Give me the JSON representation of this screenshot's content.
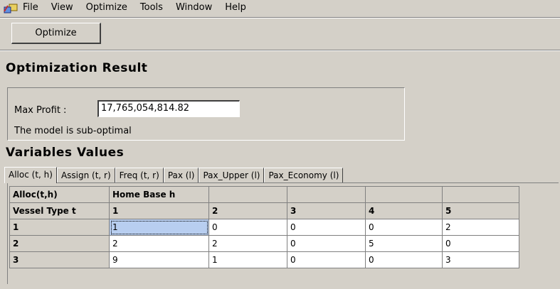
{
  "menu": {
    "app_icon": "app-window-icon",
    "items": [
      "File",
      "View",
      "Optimize",
      "Tools",
      "Window",
      "Help"
    ]
  },
  "toolbar": {
    "optimize_label": "Optimize"
  },
  "result": {
    "title": "Optimization Result",
    "max_profit_label": "Max Profit :",
    "max_profit_value": "17,765,054,814.82",
    "status_text": "The model is sub-optimal"
  },
  "variables": {
    "title": "Variables Values",
    "tabs": [
      "Alloc (t, h)",
      "Assign (t, r)",
      "Freq (t, r)",
      "Pax (l)",
      "Pax_Upper (l)",
      "Pax_Economy (l)"
    ],
    "active_tab": "Alloc (t, h)"
  },
  "grid": {
    "header_row1": [
      "Alloc(t,h)",
      "Home Base h",
      "",
      "",
      "",
      ""
    ],
    "header_row2": [
      "Vessel Type t",
      "1",
      "2",
      "3",
      "4",
      "5"
    ],
    "rows": [
      {
        "label": "1",
        "values": [
          "1",
          "0",
          "0",
          "0",
          "2"
        ]
      },
      {
        "label": "2",
        "values": [
          "2",
          "2",
          "0",
          "5",
          "0"
        ]
      },
      {
        "label": "3",
        "values": [
          "9",
          "1",
          "0",
          "0",
          "3"
        ]
      }
    ],
    "selected_cell": {
      "row": 0,
      "col": 0
    },
    "selection_color": "#b8cef0"
  },
  "colors": {
    "window_bg": "#d4d0c8",
    "cell_bg": "#ffffff"
  }
}
